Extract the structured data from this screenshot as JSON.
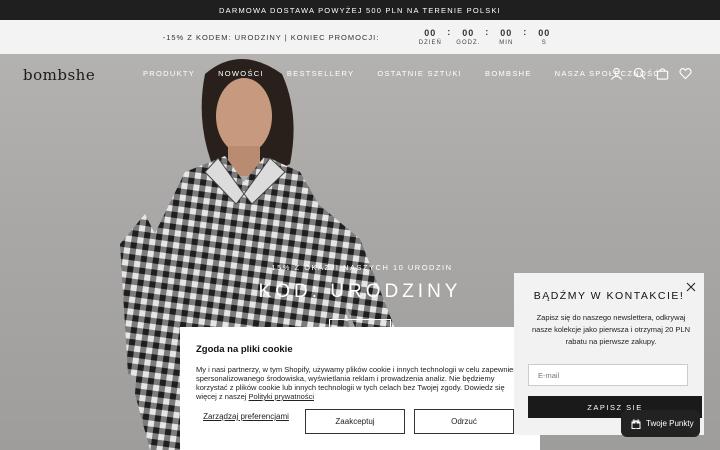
{
  "topbar": {
    "text": "DARMOWA DOSTAWA POWYŻEJ 500 PLN NA TERENIE POLSKI"
  },
  "promo": {
    "text": "-15% Z KODEM: URODZINY | KONIEC PROMOCJI:",
    "countdown": [
      {
        "value": "00",
        "label": "DZIEŃ"
      },
      {
        "value": "00",
        "label": "GODZ."
      },
      {
        "value": "00",
        "label": "MIN"
      },
      {
        "value": "00",
        "label": "S"
      }
    ]
  },
  "header": {
    "logo": "bombshe",
    "nav": [
      "PRODUKTY",
      "NOWOŚCI",
      "BESTSELLERY",
      "OSTATNIE SZTUKI",
      "BOMBSHE",
      "NASZA SPOŁECZNOŚĆ"
    ],
    "icons": [
      "account-icon",
      "search-icon",
      "bag-icon",
      "heart-icon"
    ]
  },
  "hero": {
    "subtitle": "-15% Z OKAZJI NASZYCH 10 URODZIN",
    "title": "KOD: URODZINY"
  },
  "cookie": {
    "title": "Zgoda na pliki cookie",
    "text": "My i nasi partnerzy, w tym Shopify, używamy plików cookie i innych technologii w celu zapewnienia spersonalizowanego środowiska, wyświetlania reklam i prowadzenia analiz. Nie będziemy korzystać z plików cookie lub innych technologii w tych celach bez Twojej zgody. Dowiedz się więcej z naszej",
    "link": "Polityki prywatności",
    "manage": "Zarządzaj preferencjami",
    "accept": "Zaakceptuj",
    "decline": "Odrzuć"
  },
  "newsletter": {
    "title": "BĄDŹMY W KONTAKCIE!",
    "text": "Zapisz się do naszego newslettera, odkrywaj nasze kolekcje jako pierwsza i otrzymaj 20 PLN rabatu na pierwsze zakupy.",
    "placeholder": "E-mail",
    "button": "ZAPISZ SIĘ"
  },
  "rewards": {
    "label": "Twoje Punkty"
  },
  "colors": {
    "dark": "#1f1f1f",
    "promo_bg": "#f3f3f3",
    "hero_bg": "#a9a8a7",
    "popup_bg": "#f2f2f2"
  }
}
